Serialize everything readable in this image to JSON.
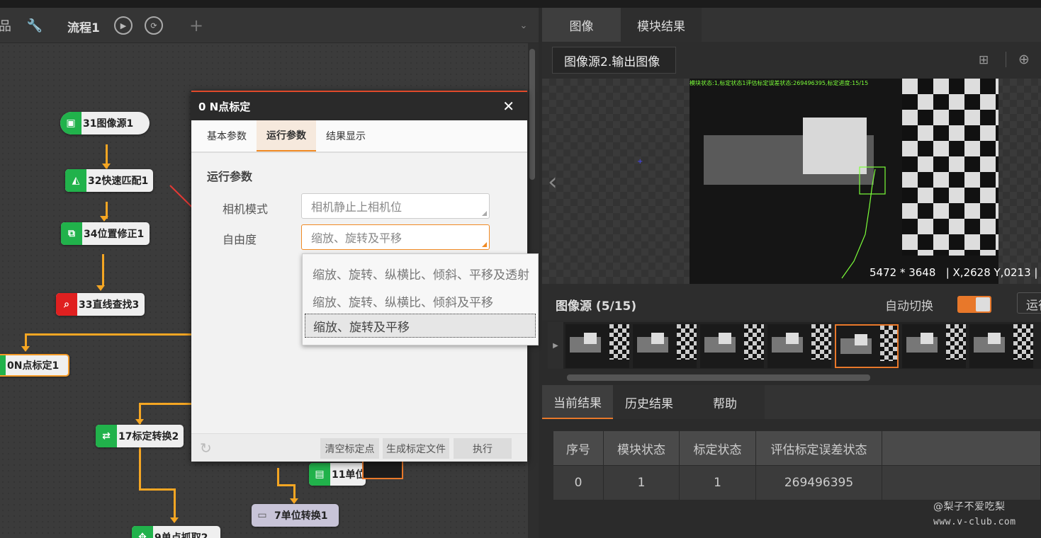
{
  "process_tab": {
    "title": "流程1",
    "add": "+"
  },
  "nodes": {
    "n31": "31图像源1",
    "n32": "32快速匹配1",
    "n34": "34位置修正1",
    "n33": "33直线查找3",
    "n0": "0N点标定1",
    "n17": "17标定转换2",
    "n11": "11单位",
    "n7": "7单位转换1",
    "n9": "9单点抓取2"
  },
  "dialog": {
    "title": "0 N点标定",
    "close": "✕",
    "tabs": [
      "基本参数",
      "运行参数",
      "结果显示"
    ],
    "active_tab": 1,
    "section": "运行参数",
    "camera_mode_label": "相机模式",
    "camera_mode_value": "相机静止上相机位",
    "dof_label": "自由度",
    "dof_value": "缩放、旋转及平移",
    "btn_clear": "清空标定点",
    "btn_gen": "生成标定文件",
    "btn_exec": "执行"
  },
  "dropdown": {
    "options": [
      "缩放、旋转、纵横比、倾斜、平移及透射",
      "缩放、旋转、纵横比、倾斜及平移",
      "缩放、旋转及平移"
    ],
    "selected_index": 2
  },
  "right": {
    "tabs": [
      "图像",
      "模块结果"
    ],
    "image_source": "图像源2.输出图像",
    "status_overlay": "模块状态:1,标定状态1评估标定误差状态:269496395,标定进度:15/15",
    "size_text": "5472 * 3648",
    "coord_text": "| X,2628  Y,0213  |",
    "source_title": "图像源 (5/15)",
    "auto_switch_label": "自动切换",
    "run_label": "运行",
    "thumb_count": 7,
    "selected_thumb": 4,
    "result_tabs": [
      "当前结果",
      "历史结果",
      "帮助"
    ],
    "table": {
      "headers": [
        "序号",
        "模块状态",
        "标定状态",
        "评估标定误差状态"
      ],
      "rows": [
        [
          "0",
          "1",
          "1",
          "269496395"
        ]
      ]
    }
  },
  "watermark": {
    "line1": "@梨子不爱吃梨",
    "line2": "www.v-club.com"
  },
  "colors": {
    "accent": "#f08a24",
    "wire": "#f5a623",
    "node_green": "#21b24b",
    "node_red": "#e02020",
    "overlay_green": "#7cff3a"
  }
}
